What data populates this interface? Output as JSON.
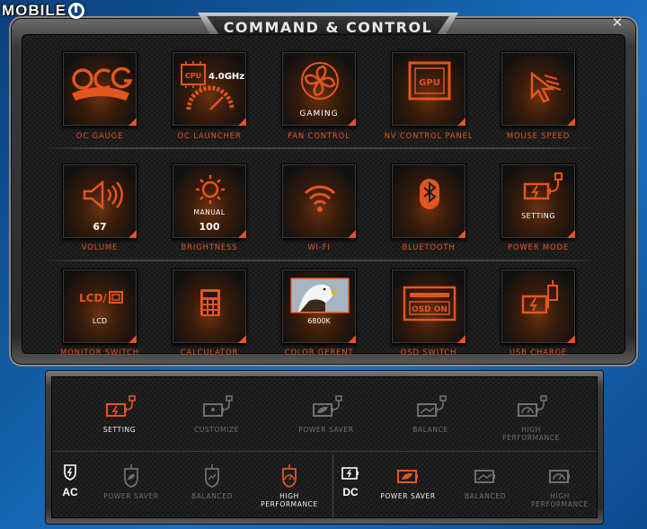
{
  "watermark": {
    "text": "MOBILE",
    "logo_suffix": "01"
  },
  "window": {
    "title": "COMMAND & CONTROL",
    "close_glyph": "✕"
  },
  "tiles": [
    {
      "id": "oc-gauge",
      "label": "OC GAUGE",
      "icon": "ocg-logo-icon",
      "sub": ""
    },
    {
      "id": "oc-launcher",
      "label": "OC LAUNCHER",
      "icon": "cpu-gauge-icon",
      "sub": "",
      "cpu_text": "CPU",
      "freq": "4.0GHz"
    },
    {
      "id": "fan-control",
      "label": "FAN CONTROL",
      "icon": "fan-icon",
      "sub": "GAMING"
    },
    {
      "id": "nv-control-panel",
      "label": "NV CONTROL PANEL",
      "icon": "gpu-icon",
      "sub": "",
      "gpu_text": "GPU"
    },
    {
      "id": "mouse-speed",
      "label": "MOUSE SPEED",
      "icon": "mouse-cursor-icon",
      "sub": ""
    },
    {
      "id": "volume",
      "label": "VOLUME",
      "icon": "speaker-icon",
      "sub": "67"
    },
    {
      "id": "brightness",
      "label": "BRIGHTNESS",
      "icon": "sun-icon",
      "sub": "100",
      "sub_top": "MANUAL"
    },
    {
      "id": "wifi",
      "label": "WI-FI",
      "icon": "wifi-icon",
      "sub": ""
    },
    {
      "id": "bluetooth",
      "label": "BLUETOOTH",
      "icon": "bluetooth-icon",
      "sub": ""
    },
    {
      "id": "power-mode",
      "label": "POWER MODE",
      "icon": "battery-plug-icon",
      "sub": "SETTING"
    },
    {
      "id": "monitor-switch",
      "label": "MONITOR SWITCH",
      "icon": "lcd-monitor-icon",
      "sub": "LCD",
      "icon_text": "LCD/"
    },
    {
      "id": "calculator",
      "label": "CALCULATOR",
      "icon": "calculator-icon",
      "sub": ""
    },
    {
      "id": "color-gerent",
      "label": "COLOR GERENT",
      "icon": "eagle-photo-icon",
      "sub": "6800K"
    },
    {
      "id": "osd-switch",
      "label": "OSD SWITCH",
      "icon": "osd-display-icon",
      "sub": "",
      "osd_text": "OSD ON"
    },
    {
      "id": "usb-charge",
      "label": "USB CHARGE",
      "icon": "usb-battery-icon",
      "sub": ""
    }
  ],
  "power_panel": {
    "top_modes": [
      {
        "label": "SETTING",
        "icon": "battery-plug-icon",
        "active": true
      },
      {
        "label": "CUSTOMIZE",
        "icon": "battery-plug-icon",
        "active": false
      },
      {
        "label": "POWER SAVER",
        "icon": "battery-leaf-icon",
        "active": false
      },
      {
        "label": "BALANCE",
        "icon": "battery-balance-icon",
        "active": false
      },
      {
        "label": "HIGH PERFORMANCE",
        "icon": "battery-gauge-icon",
        "active": false
      }
    ],
    "ac": {
      "label": "AC",
      "modes": [
        {
          "label": "POWER SAVER",
          "icon": "shield-leaf-icon",
          "active": false
        },
        {
          "label": "BALANCED",
          "icon": "shield-balance-icon",
          "active": false
        },
        {
          "label": "HIGH PERFORMANCE",
          "icon": "shield-gauge-icon",
          "active": true
        }
      ]
    },
    "dc": {
      "label": "DC",
      "modes": [
        {
          "label": "POWER SAVER",
          "icon": "battery-leaf-icon",
          "active": true
        },
        {
          "label": "BALANCED",
          "icon": "battery-balance-icon",
          "active": false
        },
        {
          "label": "HIGH PERFORMANCE",
          "icon": "battery-gauge-icon",
          "active": false
        }
      ]
    }
  },
  "colors": {
    "accent": "#e4541f",
    "inactive": "#6f6f6f",
    "text": "#f0f0f0"
  }
}
